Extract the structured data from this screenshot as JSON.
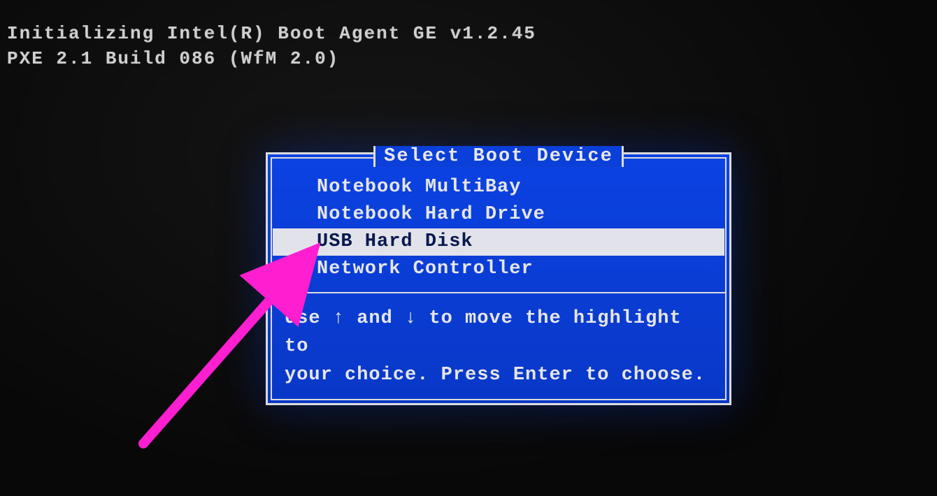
{
  "boot_messages": {
    "line1": "Initializing Intel(R) Boot Agent GE v1.2.45",
    "line2": "PXE 2.1 Build 086 (WfM 2.0)"
  },
  "dialog": {
    "title": "Select Boot Device",
    "items": [
      {
        "label": "Notebook MultiBay",
        "selected": false
      },
      {
        "label": "Notebook Hard Drive",
        "selected": false
      },
      {
        "label": "USB Hard Disk",
        "selected": true
      },
      {
        "label": "Network Controller",
        "selected": false
      }
    ],
    "help_line1": "Use ↑ and ↓ to move the highlight to",
    "help_line2": "your choice.  Press Enter to choose."
  },
  "colors": {
    "dialog_bg": "#0a3fd9",
    "selection_bg": "#e2e3ea",
    "arrow": "#ff1fd1"
  }
}
